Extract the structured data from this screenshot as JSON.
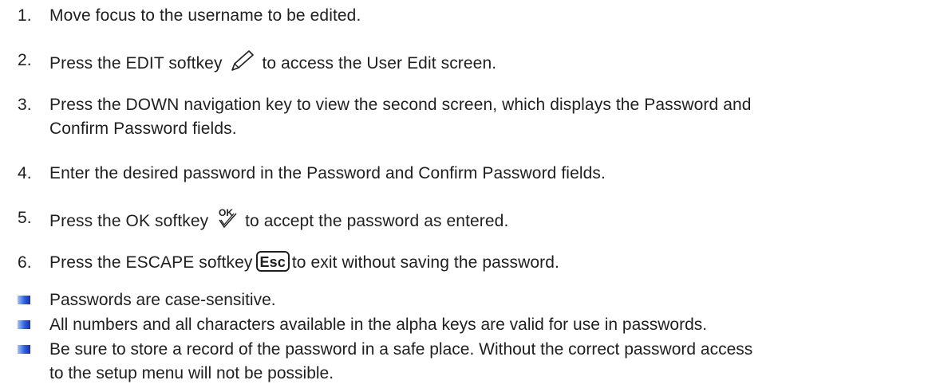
{
  "steps": [
    {
      "num": "1.",
      "text": "Move focus to the username to be edited."
    },
    {
      "num": "2.",
      "before": "Press the EDIT softkey",
      "icon": "pencil-icon",
      "after": "to access the User Edit screen."
    },
    {
      "num": "3.",
      "line1": "Press the DOWN navigation key to view the second screen, which displays the Password and",
      "line2": "Confirm Password fields."
    },
    {
      "num": "4.",
      "text": "Enter the desired password in the Password and Confirm Password fields."
    },
    {
      "num": "5.",
      "before": "Press the OK softkey",
      "icon": "ok-check-icon",
      "icon_text": "OK",
      "after": "to accept the password as entered."
    },
    {
      "num": "6.",
      "before": "Press the ESCAPE softkey",
      "icon": "esc-key-icon",
      "key_label": "Esc",
      "after": "to exit without saving the password."
    }
  ],
  "notes": [
    {
      "text": "Passwords are case-sensitive."
    },
    {
      "text": "All numbers and all characters available in the alpha keys are valid for use in passwords."
    },
    {
      "line1": "Be sure to store a record of the password in a safe place. Without the correct password access",
      "line2": "to the setup menu will not be possible."
    }
  ],
  "colors": {
    "text": "#1f1f1f",
    "bullet_dark": "#1a2fa8",
    "bullet_light": "#9cc4ff"
  }
}
